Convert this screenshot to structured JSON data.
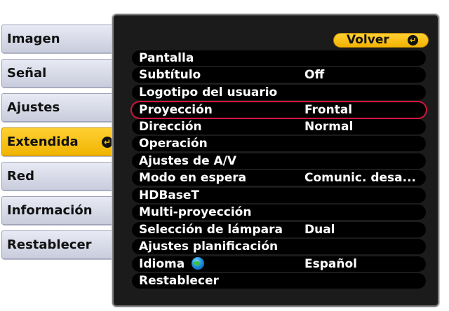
{
  "tabs": [
    {
      "label": "Imagen",
      "active": false
    },
    {
      "label": "Señal",
      "active": false
    },
    {
      "label": "Ajustes",
      "active": false
    },
    {
      "label": "Extendida",
      "active": true
    },
    {
      "label": "Red",
      "active": false
    },
    {
      "label": "Información",
      "active": false
    },
    {
      "label": "Restablecer",
      "active": false
    }
  ],
  "panel": {
    "back_label": "Volver",
    "back_icon": "enter-icon",
    "items": [
      {
        "label": "Pantalla",
        "value": ""
      },
      {
        "label": "Subtítulo",
        "value": "Off"
      },
      {
        "label": "Logotipo del usuario",
        "value": ""
      },
      {
        "label": "Proyección",
        "value": "Frontal",
        "selected": true
      },
      {
        "label": "Dirección",
        "value": "Normal"
      },
      {
        "label": "Operación",
        "value": ""
      },
      {
        "label": "Ajustes de A/V",
        "value": ""
      },
      {
        "label": "Modo en espera",
        "value": "Comunic. desa..."
      },
      {
        "label": "HDBaseT",
        "value": ""
      },
      {
        "label": "Multi-proyección",
        "value": ""
      },
      {
        "label": "Selección de lámpara",
        "value": "Dual"
      },
      {
        "label": "Ajustes planificación",
        "value": ""
      },
      {
        "label": "Idioma",
        "value": "Español",
        "icon": "globe-icon"
      },
      {
        "label": "Restablecer",
        "value": ""
      }
    ]
  },
  "colors": {
    "accent": "#f6c20c",
    "panel_bg": "#1b1b1b",
    "selection_border": "#d0163a"
  }
}
